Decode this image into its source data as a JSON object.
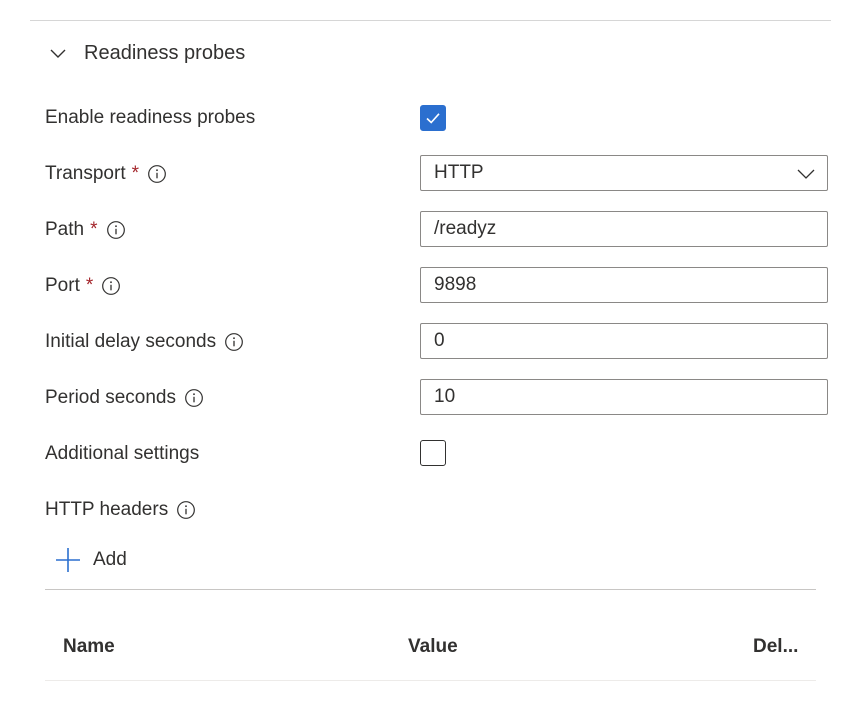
{
  "section": {
    "title": "Readiness probes",
    "expanded": true
  },
  "fields": {
    "enable": {
      "label": "Enable readiness probes",
      "checked": true
    },
    "transport": {
      "label": "Transport",
      "required_mark": "*",
      "value": "HTTP",
      "info_icon": "info-icon"
    },
    "path": {
      "label": "Path",
      "required_mark": "*",
      "value": "/readyz",
      "info_icon": "info-icon"
    },
    "port": {
      "label": "Port",
      "required_mark": "*",
      "value": "9898",
      "info_icon": "info-icon"
    },
    "initial_delay": {
      "label": "Initial delay seconds",
      "value": "0",
      "info_icon": "info-icon"
    },
    "period": {
      "label": "Period seconds",
      "value": "10",
      "info_icon": "info-icon"
    },
    "additional": {
      "label": "Additional settings",
      "checked": false
    }
  },
  "http_headers": {
    "label": "HTTP headers",
    "info_icon": "info-icon",
    "add_label": "Add",
    "columns": [
      "Name",
      "Value",
      "Del..."
    ]
  },
  "colors": {
    "accent": "#2b6fcf",
    "required": "#a4262c",
    "text": "#323130",
    "border": "#8a8886"
  }
}
